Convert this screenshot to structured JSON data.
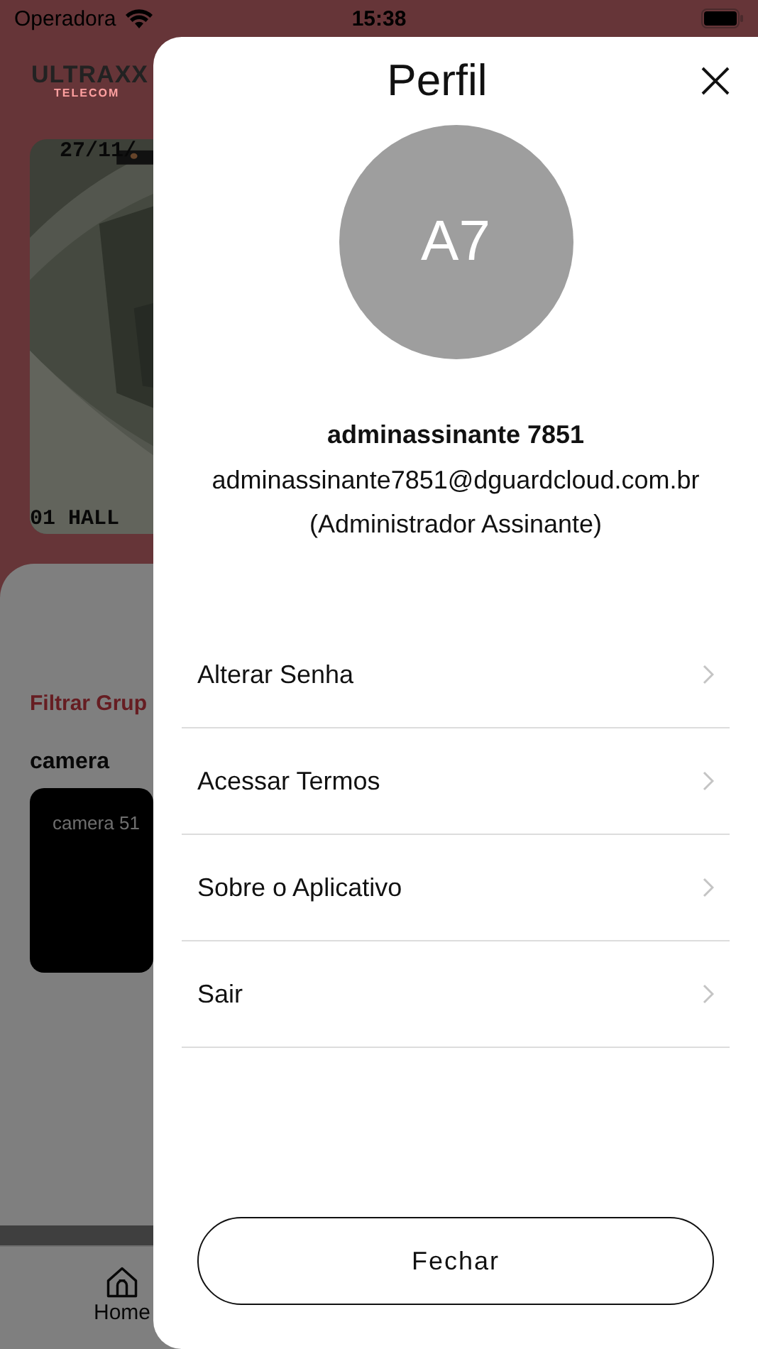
{
  "status_bar": {
    "carrier": "Operadora",
    "time": "15:38"
  },
  "background": {
    "logo": {
      "name": "ULTRAXX",
      "tagline": "TELECOM"
    },
    "camera_view": {
      "timestamp": "27/11/",
      "label": "01 HALL"
    },
    "filter_label": "Filtrar Grup",
    "group_title": "camera",
    "camera_tile": {
      "label": "camera 51"
    },
    "tab_bar": [
      {
        "label": "Home",
        "selected": true
      }
    ]
  },
  "profile": {
    "title": "Perfil",
    "avatar_initials": "A7",
    "name": "adminassinante 7851",
    "email": "adminassinante7851@dguardcloud.com.br",
    "role": "(Administrador Assinante)",
    "menu": [
      {
        "label": "Alterar Senha"
      },
      {
        "label": "Acessar Termos"
      },
      {
        "label": "Sobre o Aplicativo"
      },
      {
        "label": "Sair"
      }
    ],
    "close_button": "Fechar"
  }
}
